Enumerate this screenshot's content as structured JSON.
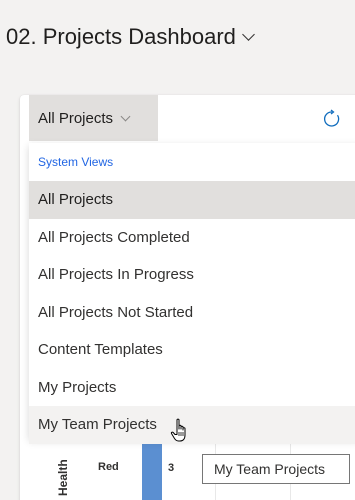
{
  "header": {
    "title": "02. Projects Dashboard"
  },
  "view_selector": {
    "label": "All Projects"
  },
  "dropdown": {
    "group_label": "System Views",
    "options": [
      "All Projects",
      "All Projects Completed",
      "All Projects In Progress",
      "All Projects Not Started",
      "Content Templates",
      "My Projects",
      "My Team Projects"
    ],
    "selected": "All Projects",
    "hovered": "My Team Projects"
  },
  "chart_fragment": {
    "axis_label": "Health",
    "category": "Red",
    "value": "3"
  },
  "tooltip": {
    "text": "My Team Projects"
  },
  "colors": {
    "link_blue": "#2266e3",
    "bar_blue": "#5b8fd1",
    "selected_bg": "#e1dfdd"
  },
  "icons": [
    "chevron-down-icon",
    "refresh-icon",
    "hand-pointer-icon"
  ]
}
